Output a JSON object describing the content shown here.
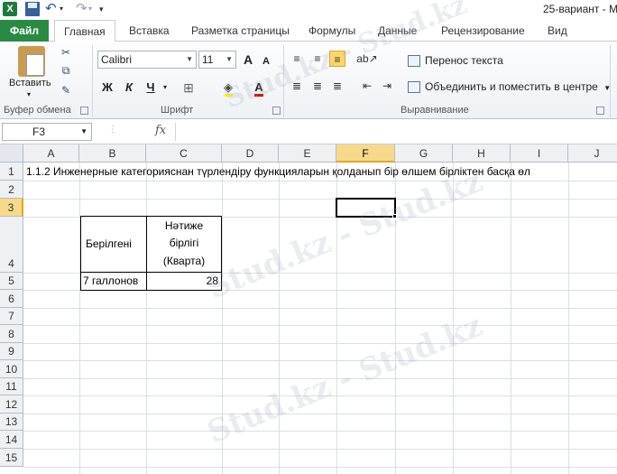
{
  "window": {
    "title": "25-вариант - M",
    "app_logo": "X"
  },
  "quick_access": {
    "icons": [
      "excel-icon",
      "save-icon",
      "undo-icon",
      "redo-icon"
    ]
  },
  "tabs": {
    "file": "Файл",
    "items": [
      "Главная",
      "Вставка",
      "Разметка страницы",
      "Формулы",
      "Данные",
      "Рецензирование",
      "Вид"
    ]
  },
  "ribbon": {
    "clipboard": {
      "paste": "Вставить",
      "group": "Буфер обмена"
    },
    "font": {
      "name": "Calibri",
      "size": "11",
      "bold": "Ж",
      "italic": "К",
      "underline": "Ч",
      "group": "Шрифт",
      "grow": "A",
      "shrink": "A"
    },
    "alignment": {
      "wrap_text": "Перенос текста",
      "merge_center": "Объединить и поместить в центре",
      "group": "Выравнивание"
    }
  },
  "formula_bar": {
    "name_box": "F3",
    "fx": "fx",
    "value": ""
  },
  "sheet": {
    "columns": [
      "A",
      "B",
      "C",
      "D",
      "E",
      "F",
      "G",
      "H",
      "I",
      "J"
    ],
    "rows": [
      "1",
      "2",
      "3",
      "4",
      "5",
      "6",
      "7",
      "8",
      "9",
      "10",
      "11",
      "12",
      "13",
      "14",
      "15"
    ],
    "selected_column": "F",
    "selected_row": "3",
    "a1": "1.1.2 Инженерные категорияснан түрлендіру функцияларын қолданып бір өлшем бірліктен басқа өл",
    "b4": "Берілгені",
    "c4_line1": "Нәтиже",
    "c4_line2": "бірлігі",
    "c4_line3": "(Кварта)",
    "b5": "7 галлонов",
    "c5": "28"
  },
  "watermark": "Stud.kz - Stud.kz"
}
